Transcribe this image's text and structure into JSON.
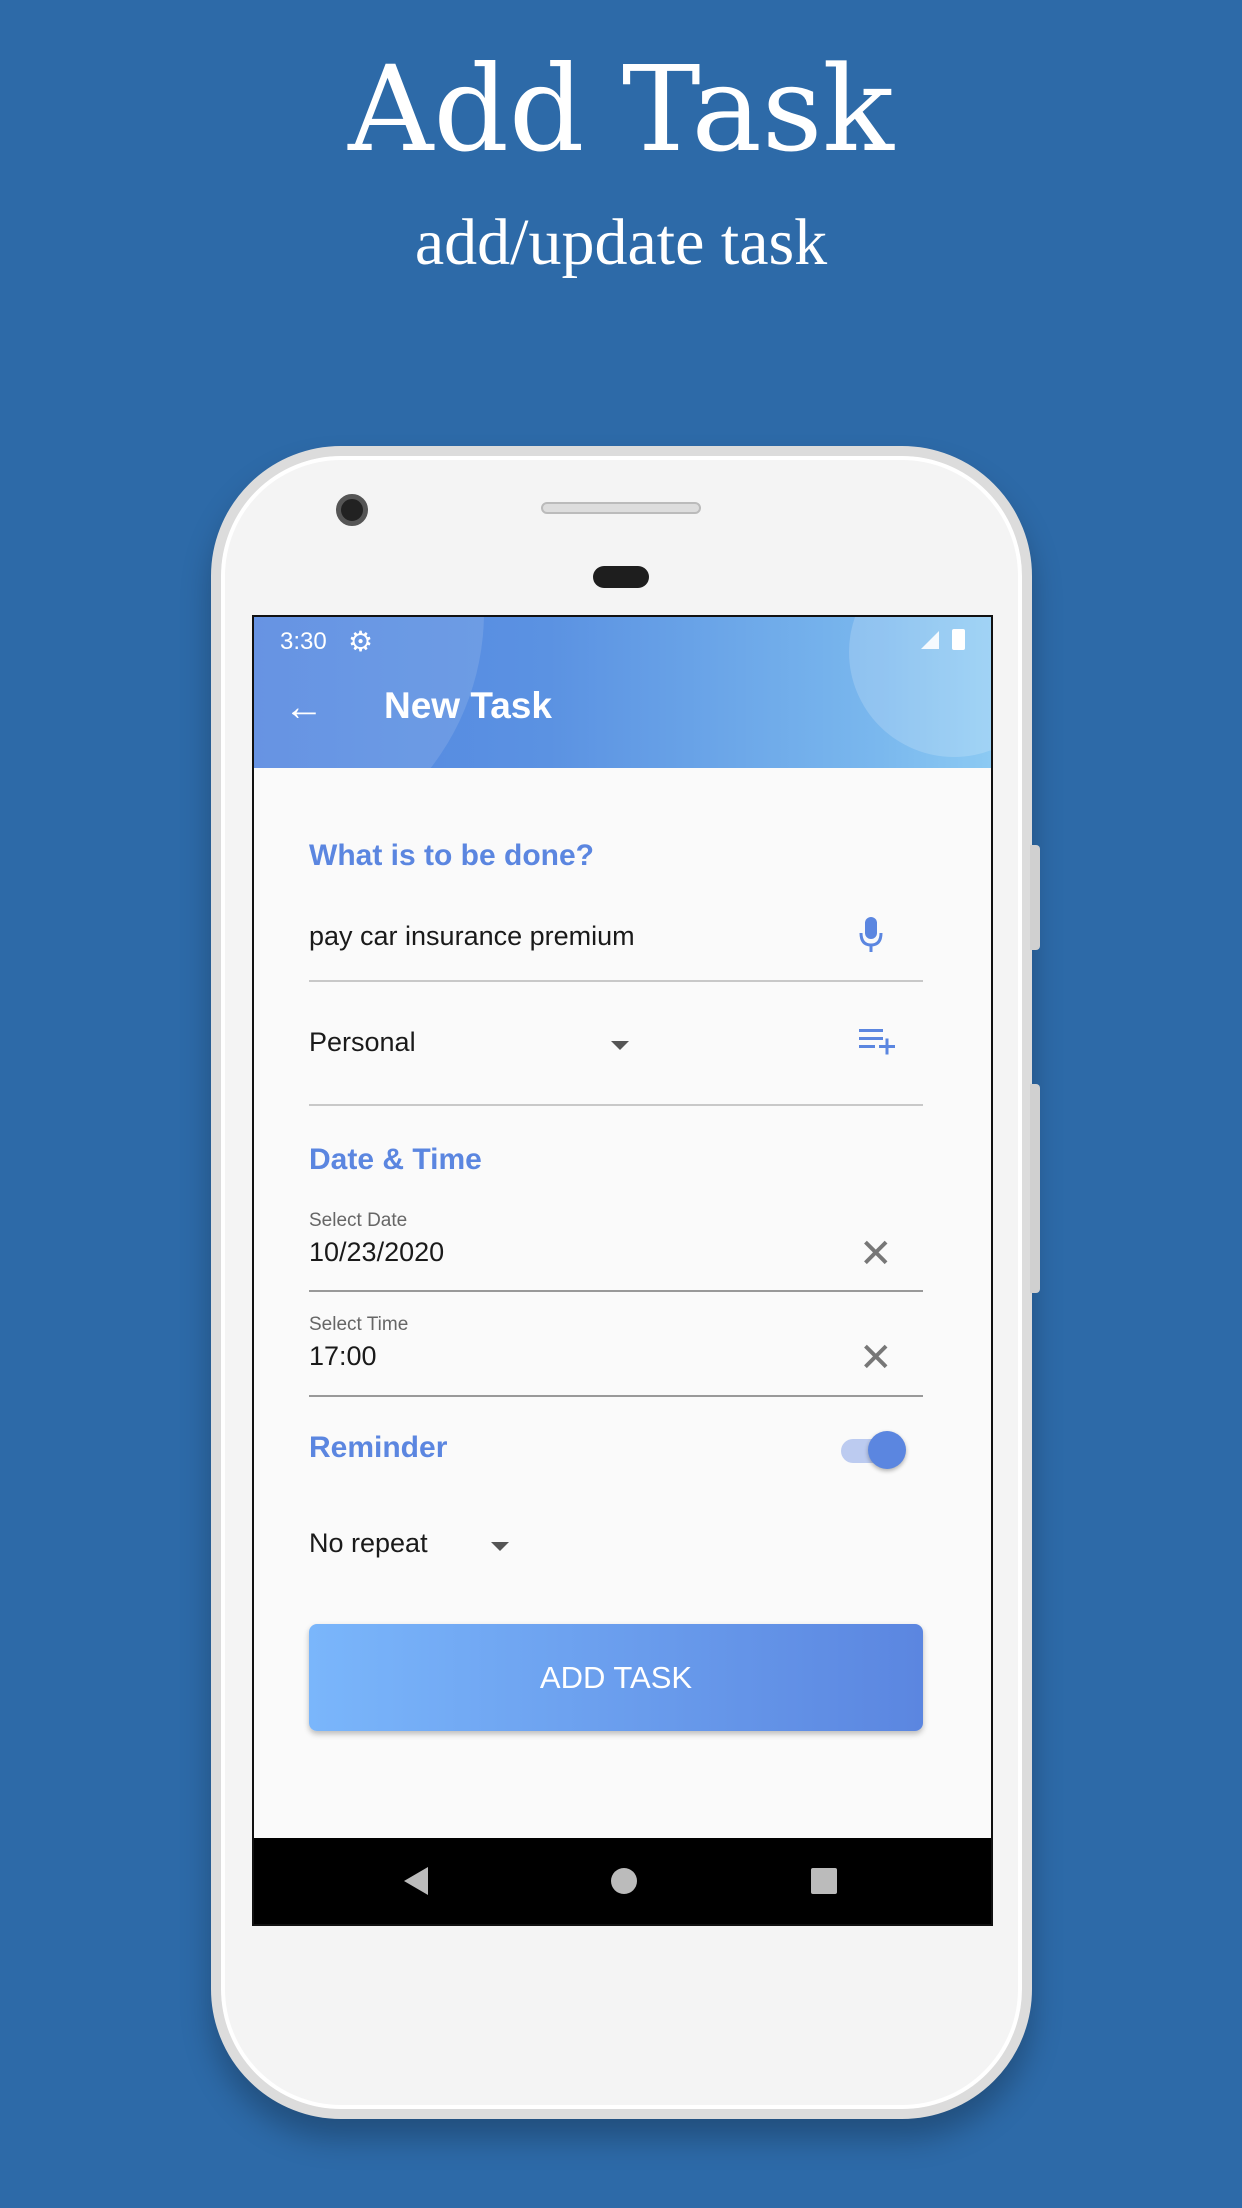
{
  "hero": {
    "title": "Add Task",
    "subtitle": "add/update task"
  },
  "status_bar": {
    "time": "3:30",
    "icons": [
      "gear-icon",
      "signal-icon",
      "battery-icon"
    ]
  },
  "app_bar": {
    "title": "New Task",
    "back_icon": "arrow-left-icon"
  },
  "form": {
    "task_section": "What is to be done?",
    "task_value": "pay car insurance premium",
    "mic_icon": "microphone-icon",
    "list_value": "Personal",
    "add_list_icon": "playlist-add-icon",
    "datetime_section": "Date & Time",
    "date_label": "Select Date",
    "date_value": "10/23/2020",
    "time_label": "Select Time",
    "time_value": "17:00",
    "reminder_label": "Reminder",
    "reminder_on": true,
    "repeat_value": "No repeat",
    "submit_label": "ADD TASK"
  },
  "colors": {
    "accent": "#5b86e0",
    "background": "#2d6aa8",
    "button_start": "#7ab6fb",
    "button_end": "#5b86e0"
  }
}
